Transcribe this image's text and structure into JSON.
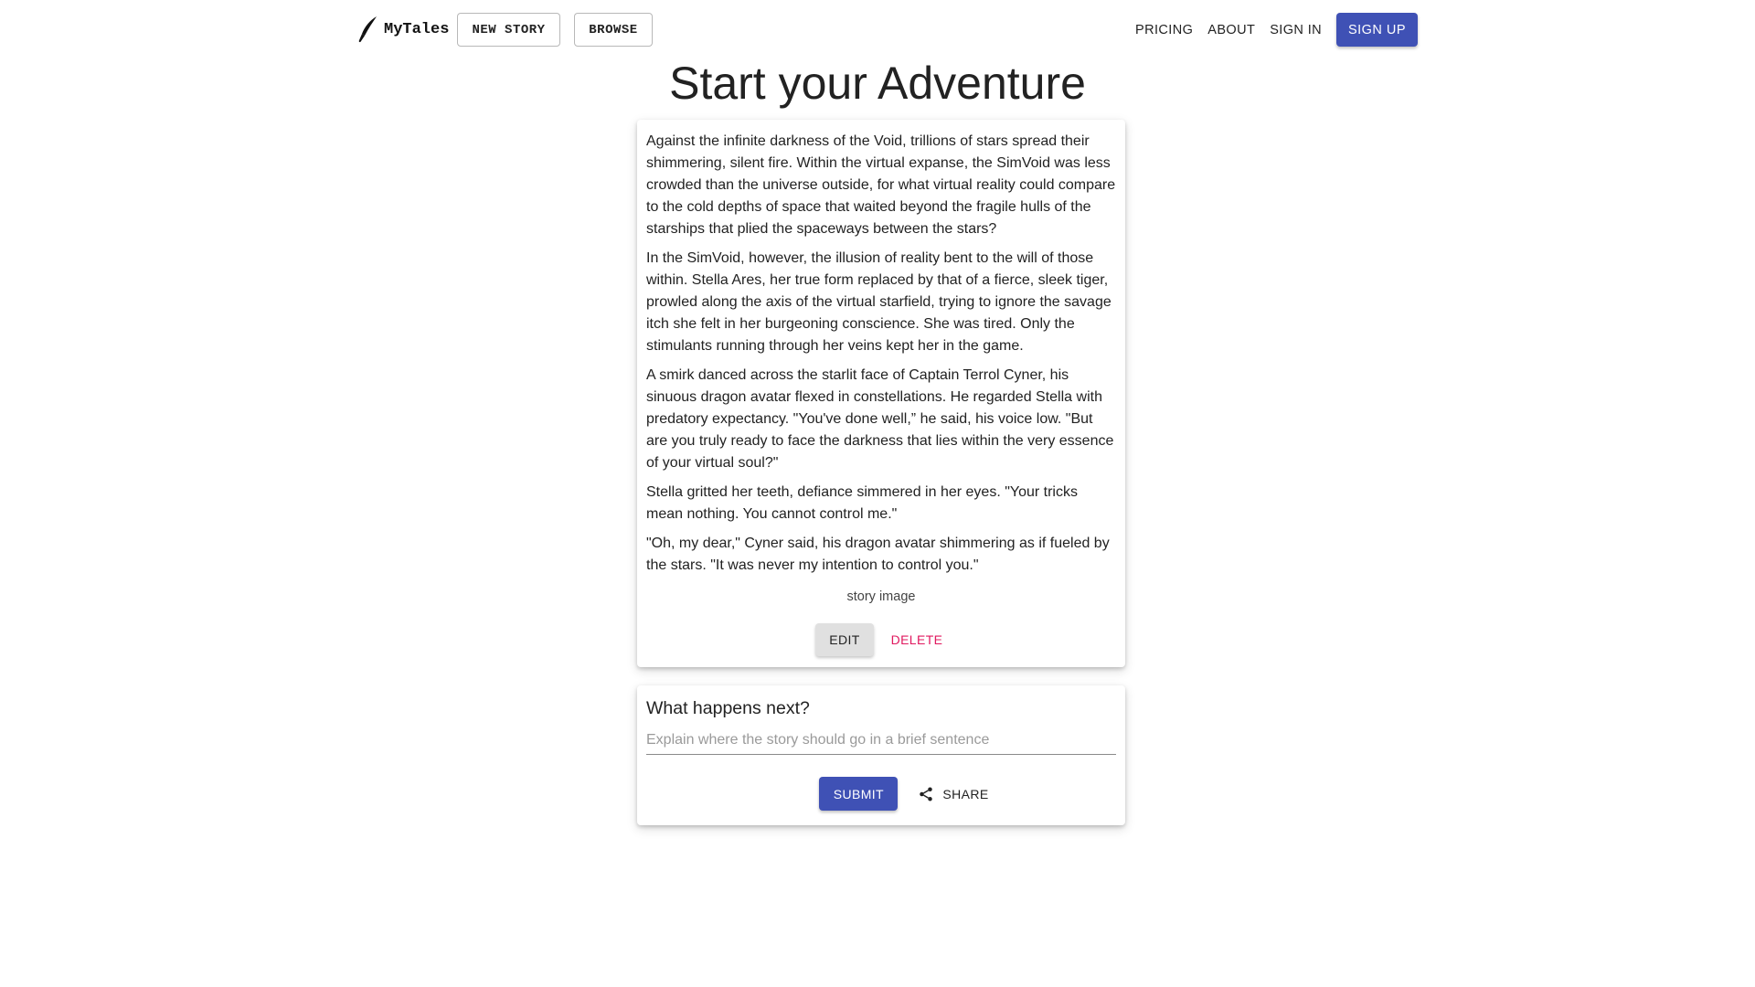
{
  "header": {
    "brand_name": "MyTales",
    "brand_icon": "quill-pen-icon",
    "new_story_label": "NEW STORY",
    "browse_label": "BROWSE",
    "nav_links": {
      "pricing": "PRICING",
      "about": "ABOUT",
      "sign_in": "SIGN IN"
    },
    "sign_up_label": "SIGN UP"
  },
  "page": {
    "title": "Start your Adventure"
  },
  "story": {
    "paragraphs": [
      "Against the infinite darkness of the Void, trillions of stars spread their shimmering, silent fire. Within the virtual expanse, the SimVoid was less crowded than the universe outside, for what virtual reality could compare to the cold depths of space that waited beyond the fragile hulls of the starships that plied the spaceways between the stars?",
      "In the SimVoid, however, the illusion of reality bent to the will of those within. Stella Ares, her true form replaced by that of a fierce, sleek tiger, prowled along the axis of the virtual starfield, trying to ignore the savage itch she felt in her burgeoning conscience. She was tired. Only the stimulants running through her veins kept her in the game.",
      "A smirk danced across the starlit face of Captain Terrol Cyner, his sinuous dragon avatar flexed in constellations. He regarded Stella with predatory expectancy. \"You've done well,” he said, his voice low. \"But are you truly ready to face the darkness that lies within the very essence of your virtual soul?\"",
      "Stella gritted her teeth, defiance simmered in her eyes. \"Your tricks mean nothing. You cannot control me.\"",
      "\"Oh, my dear,\" Cyner said, his dragon avatar shimmering as if fueled by the stars. \"It was never my intention to control you.\""
    ],
    "image_alt": "story image",
    "edit_label": "EDIT",
    "delete_label": "DELETE"
  },
  "next": {
    "heading": "What happens next?",
    "input_value": "",
    "input_placeholder": "Explain where the story should go in a brief sentence",
    "submit_label": "SUBMIT",
    "share_label": "SHARE",
    "share_icon": "share-icon"
  },
  "colors": {
    "primary": "#3f51b5",
    "delete": "#e0195f"
  }
}
